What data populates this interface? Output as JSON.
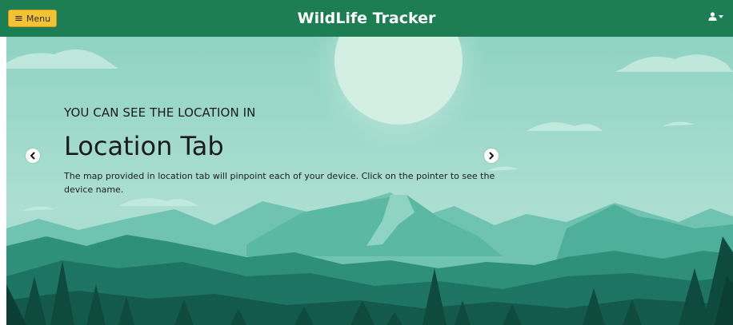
{
  "header": {
    "menu_label": "Menu",
    "menu_icon": "hamburger-icon",
    "brand": "WildLife Tracker",
    "user_icon": "user-icon",
    "user_caret_icon": "caret-down-icon"
  },
  "carousel": {
    "active_slide": {
      "kicker": "YOU CAN SEE THE LOCATION IN",
      "title": "Location Tab",
      "description": "The map provided in location tab will pinpoint each of your device. Click on the pointer to see the device name."
    },
    "prev_icon": "chevron-left-icon",
    "next_icon": "chevron-right-icon"
  },
  "colors": {
    "header_bg": "#1d7d53",
    "menu_button_bg": "#f3c333",
    "sky": "#a8ddd0",
    "forest_dark": "#0f4a3e"
  }
}
